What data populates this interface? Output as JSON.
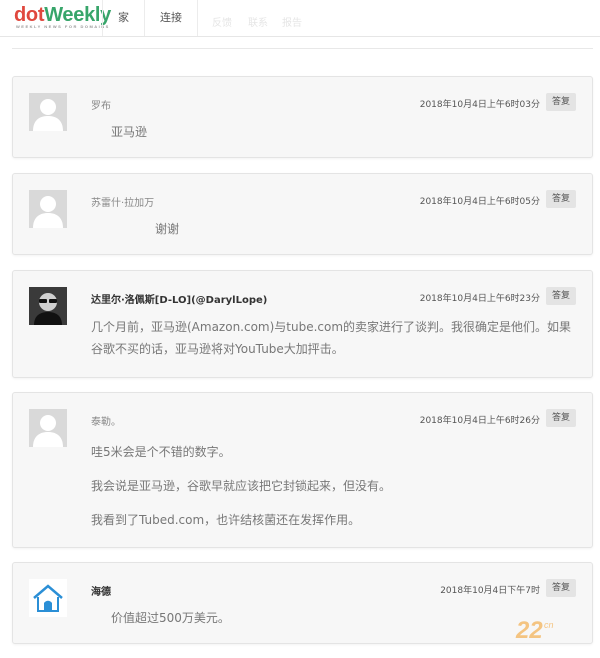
{
  "brand": {
    "dot": "dot",
    "weekly": "Weekly",
    "tagline": "WEEKLY NEWS FOR DOMAINS"
  },
  "nav": {
    "items": [
      {
        "label": "家"
      },
      {
        "label": "连接"
      }
    ]
  },
  "faint_nav": [
    "反馈",
    "联系",
    "报告"
  ],
  "reply_label": "答复",
  "comments": [
    {
      "author": "罗布",
      "date": "2018年10月4日上午6时03分",
      "paragraphs": [
        "亚马逊"
      ]
    },
    {
      "author": "苏雷什·拉加万",
      "date": "2018年10月4日上午6时05分",
      "paragraphs": [
        "谢谢"
      ]
    },
    {
      "author": "达里尔·洛佩斯[D-LO](@DarylLope)",
      "date": "2018年10月4日上午6时23分",
      "paragraphs": [
        "几个月前，亚马逊(Amazon.com)与tube.com的卖家进行了谈判。我很确定是他们。如果谷歌不买的话，亚马逊将对YouTube大加抨击。"
      ]
    },
    {
      "author": "泰勒。",
      "date": "2018年10月4日上午6时26分",
      "paragraphs": [
        "哇5米会是个不错的数字。",
        "我会说是亚马逊，谷歌早就应该把它封锁起来，但没有。",
        "我看到了Tubed.com，也许结核菌还在发挥作用。"
      ]
    },
    {
      "author": "海德",
      "date": "2018年10月4日下午7时",
      "paragraphs": [
        "价值超过500万美元。"
      ]
    }
  ],
  "watermark": {
    "text": "22",
    "suffix": "cn"
  },
  "colors": {
    "brand_red": "#e0483e",
    "brand_green": "#37a56a",
    "watermark": "#f3b35a",
    "house_icon": "#2b8fd6"
  }
}
